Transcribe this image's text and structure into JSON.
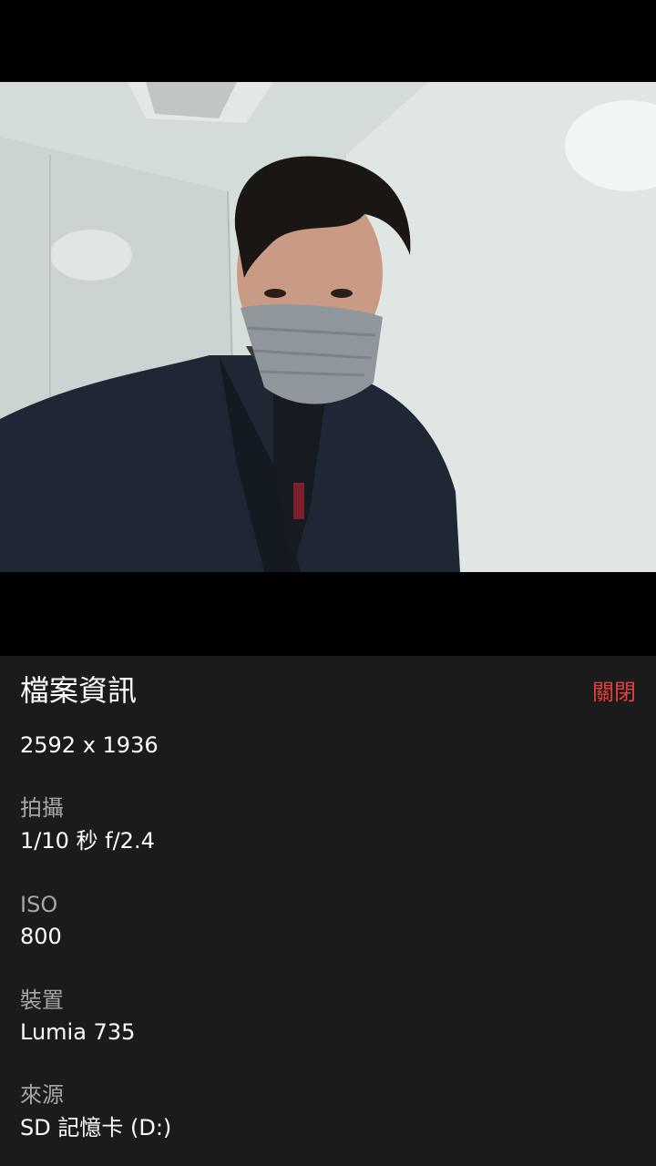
{
  "photo": {
    "description_icon": "photo-image"
  },
  "info_panel": {
    "title": "檔案資訊",
    "close_label": "關閉",
    "resolution": "2592 x 1936",
    "fields": [
      {
        "label": "拍攝",
        "value": "1/10 秒 f/2.4"
      },
      {
        "label": "ISO",
        "value": "800"
      },
      {
        "label": "裝置",
        "value": "Lumia 735"
      },
      {
        "label": "來源",
        "value": "SD 記憶卡 (D:)"
      }
    ]
  },
  "colors": {
    "accent": "#e3403c",
    "panel_background": "#1b1b1b",
    "label_gray": "#a6a6a6"
  }
}
